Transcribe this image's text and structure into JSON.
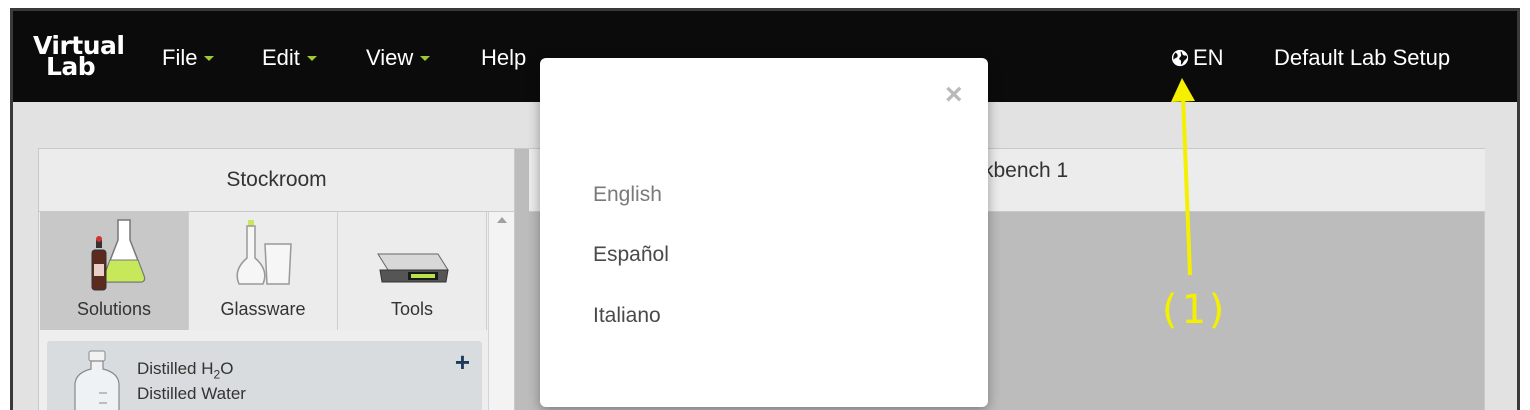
{
  "navbar": {
    "brand_line1": "Virtual",
    "brand_line2": "Lab",
    "menus": [
      "File",
      "Edit",
      "View",
      "Help"
    ],
    "language_code": "EN",
    "lab_setup": "Default Lab Setup"
  },
  "stockroom": {
    "title": "Stockroom",
    "tabs": [
      "Solutions",
      "Glassware",
      "Tools"
    ],
    "items": [
      {
        "name_prefix": "Distilled H",
        "name_sub": "2",
        "name_suffix": "O",
        "description": "Distilled Water"
      }
    ]
  },
  "workbench": {
    "title_visible": "kbench 1"
  },
  "language_modal": {
    "options": [
      "English",
      "Español",
      "Italiano"
    ],
    "selected": "English"
  },
  "annotation": {
    "label": "(1)",
    "color": "#f4f000"
  },
  "colors": {
    "navbar": "#0b0b0b",
    "accent_caret": "#9ccc2b",
    "background": "#e2e2e2"
  }
}
